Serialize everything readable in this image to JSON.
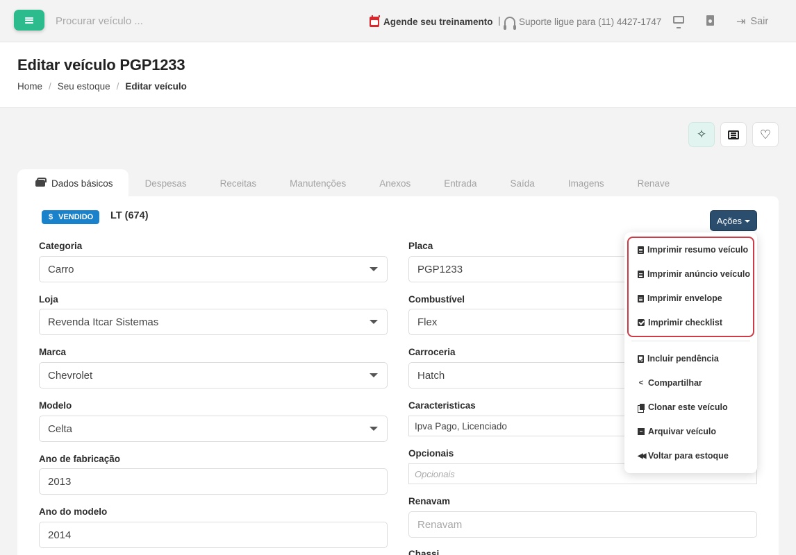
{
  "topbar": {
    "search_placeholder": "Procurar veículo ...",
    "training": "Agende seu treinamento",
    "separator": "|",
    "support": "Suporte ligue para (11) 4427-1747",
    "logout": "Sair"
  },
  "header": {
    "title": "Editar veículo PGP1233",
    "breadcrumb": [
      "Home",
      "Seu estoque",
      "Editar veículo"
    ]
  },
  "tabs": [
    "Dados básicos",
    "Despesas",
    "Receitas",
    "Manutenções",
    "Anexos",
    "Entrada",
    "Saída",
    "Imagens",
    "Renave"
  ],
  "card": {
    "badge": "VENDIDO",
    "badge_symbol": "$",
    "lot": "LT (674)",
    "actions_label": "Ações"
  },
  "form_left": [
    {
      "label": "Categoria",
      "value": "Carro"
    },
    {
      "label": "Loja",
      "value": "Revenda Itcar Sistemas"
    },
    {
      "label": "Marca",
      "value": "Chevrolet"
    },
    {
      "label": "Modelo",
      "value": "Celta"
    },
    {
      "label": "Ano de fabricação",
      "value": "2013"
    },
    {
      "label": "Ano do modelo",
      "value": "2014"
    }
  ],
  "form_right": [
    {
      "label": "Placa",
      "value": "PGP1233"
    },
    {
      "label": "Combustível",
      "value": "Flex"
    },
    {
      "label": "Carroceria",
      "value": "Hatch"
    },
    {
      "label": "Caracteristicas",
      "value": "Ipva Pago, Licenciado"
    },
    {
      "label": "Opcionais",
      "placeholder": "Opcionais"
    },
    {
      "label": "Renavam",
      "placeholder": "Renavam"
    },
    {
      "label": "Chassi"
    }
  ],
  "actions_menu": {
    "highlighted": [
      {
        "label": "Imprimir resumo veículo",
        "icon": "file-icon"
      },
      {
        "label": "Imprimir anúncio veículo",
        "icon": "file-icon"
      },
      {
        "label": "Imprimir envelope",
        "icon": "file-icon"
      },
      {
        "label": "Imprimir checklist",
        "icon": "checkbox-icon"
      }
    ],
    "other": [
      {
        "label": "Incluir pendência",
        "icon": "clipboard-check-icon"
      },
      {
        "label": "Compartilhar",
        "icon": "share-icon"
      },
      {
        "label": "Clonar este veículo",
        "icon": "copy-icon"
      },
      {
        "label": "Arquivar veículo",
        "icon": "archive-icon"
      },
      {
        "label": "Voltar para estoque",
        "icon": "backward-icon"
      }
    ]
  },
  "colors": {
    "brand_green": "#2bbb8c",
    "badge_blue": "#1a82cb",
    "actions_button": "#2b4e6e",
    "highlight_red": "#cd3b47"
  }
}
